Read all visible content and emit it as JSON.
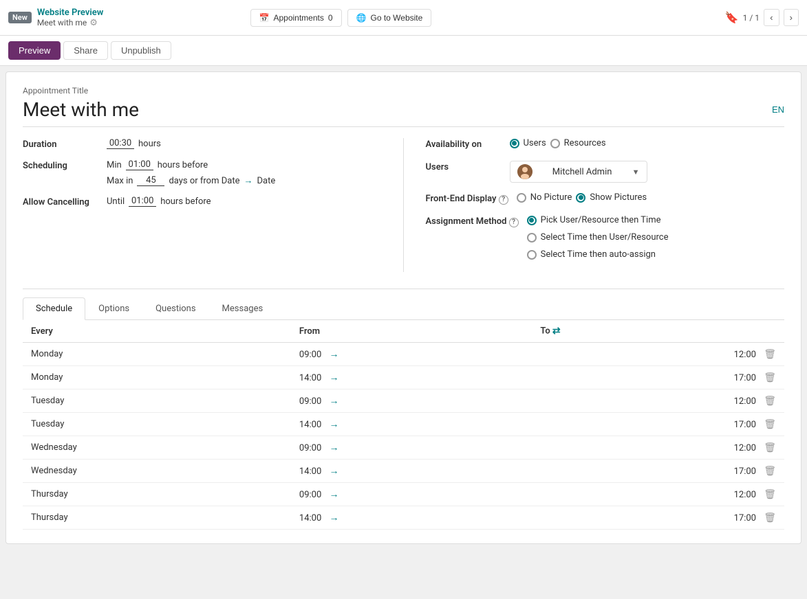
{
  "topbar": {
    "new_badge": "New",
    "website_preview": "Website Preview",
    "meet_with_me": "Meet with me",
    "appointments_label": "Appointments",
    "appointments_count": "0",
    "go_to_website_label": "Go to Website",
    "page_indicator": "1 / 1"
  },
  "actionbar": {
    "preview": "Preview",
    "share": "Share",
    "unpublish": "Unpublish"
  },
  "form": {
    "appointment_title_label": "Appointment Title",
    "appointment_title": "Meet with me",
    "language": "EN",
    "duration_label": "Duration",
    "duration_value": "00:30",
    "duration_unit": "hours",
    "scheduling_label": "Scheduling",
    "scheduling_min": "01:00",
    "scheduling_min_label": "Min",
    "scheduling_min_suffix": "hours before",
    "scheduling_max_label": "Max in",
    "scheduling_max_days": "45",
    "scheduling_max_suffix": "days or from Date",
    "scheduling_arrow": "→",
    "scheduling_date": "Date",
    "allow_cancelling_label": "Allow Cancelling",
    "allow_cancelling_value": "01:00",
    "allow_cancelling_suffix": "hours before",
    "availability_label": "Availability on",
    "availability_users": "Users",
    "availability_resources": "Resources",
    "users_label": "Users",
    "users_value": "Mitchell Admin",
    "frontend_display_label": "Front-End Display",
    "frontend_no_picture": "No Picture",
    "frontend_show_pictures": "Show Pictures",
    "assignment_method_label": "Assignment Method",
    "assignment_opt1": "Pick User/Resource then Time",
    "assignment_opt2": "Select Time then User/Resource",
    "assignment_opt3": "Select Time then auto-assign"
  },
  "tabs": {
    "schedule": "Schedule",
    "options": "Options",
    "questions": "Questions",
    "messages": "Messages"
  },
  "table": {
    "col_every": "Every",
    "col_from": "From",
    "col_to": "To",
    "rows": [
      {
        "day": "Monday",
        "from": "09:00",
        "to": "12:00"
      },
      {
        "day": "Monday",
        "from": "14:00",
        "to": "17:00"
      },
      {
        "day": "Tuesday",
        "from": "09:00",
        "to": "12:00"
      },
      {
        "day": "Tuesday",
        "from": "14:00",
        "to": "17:00"
      },
      {
        "day": "Wednesday",
        "from": "09:00",
        "to": "12:00"
      },
      {
        "day": "Wednesday",
        "from": "14:00",
        "to": "17:00"
      },
      {
        "day": "Thursday",
        "from": "09:00",
        "to": "12:00"
      },
      {
        "day": "Thursday",
        "from": "14:00",
        "to": "17:00"
      }
    ]
  }
}
